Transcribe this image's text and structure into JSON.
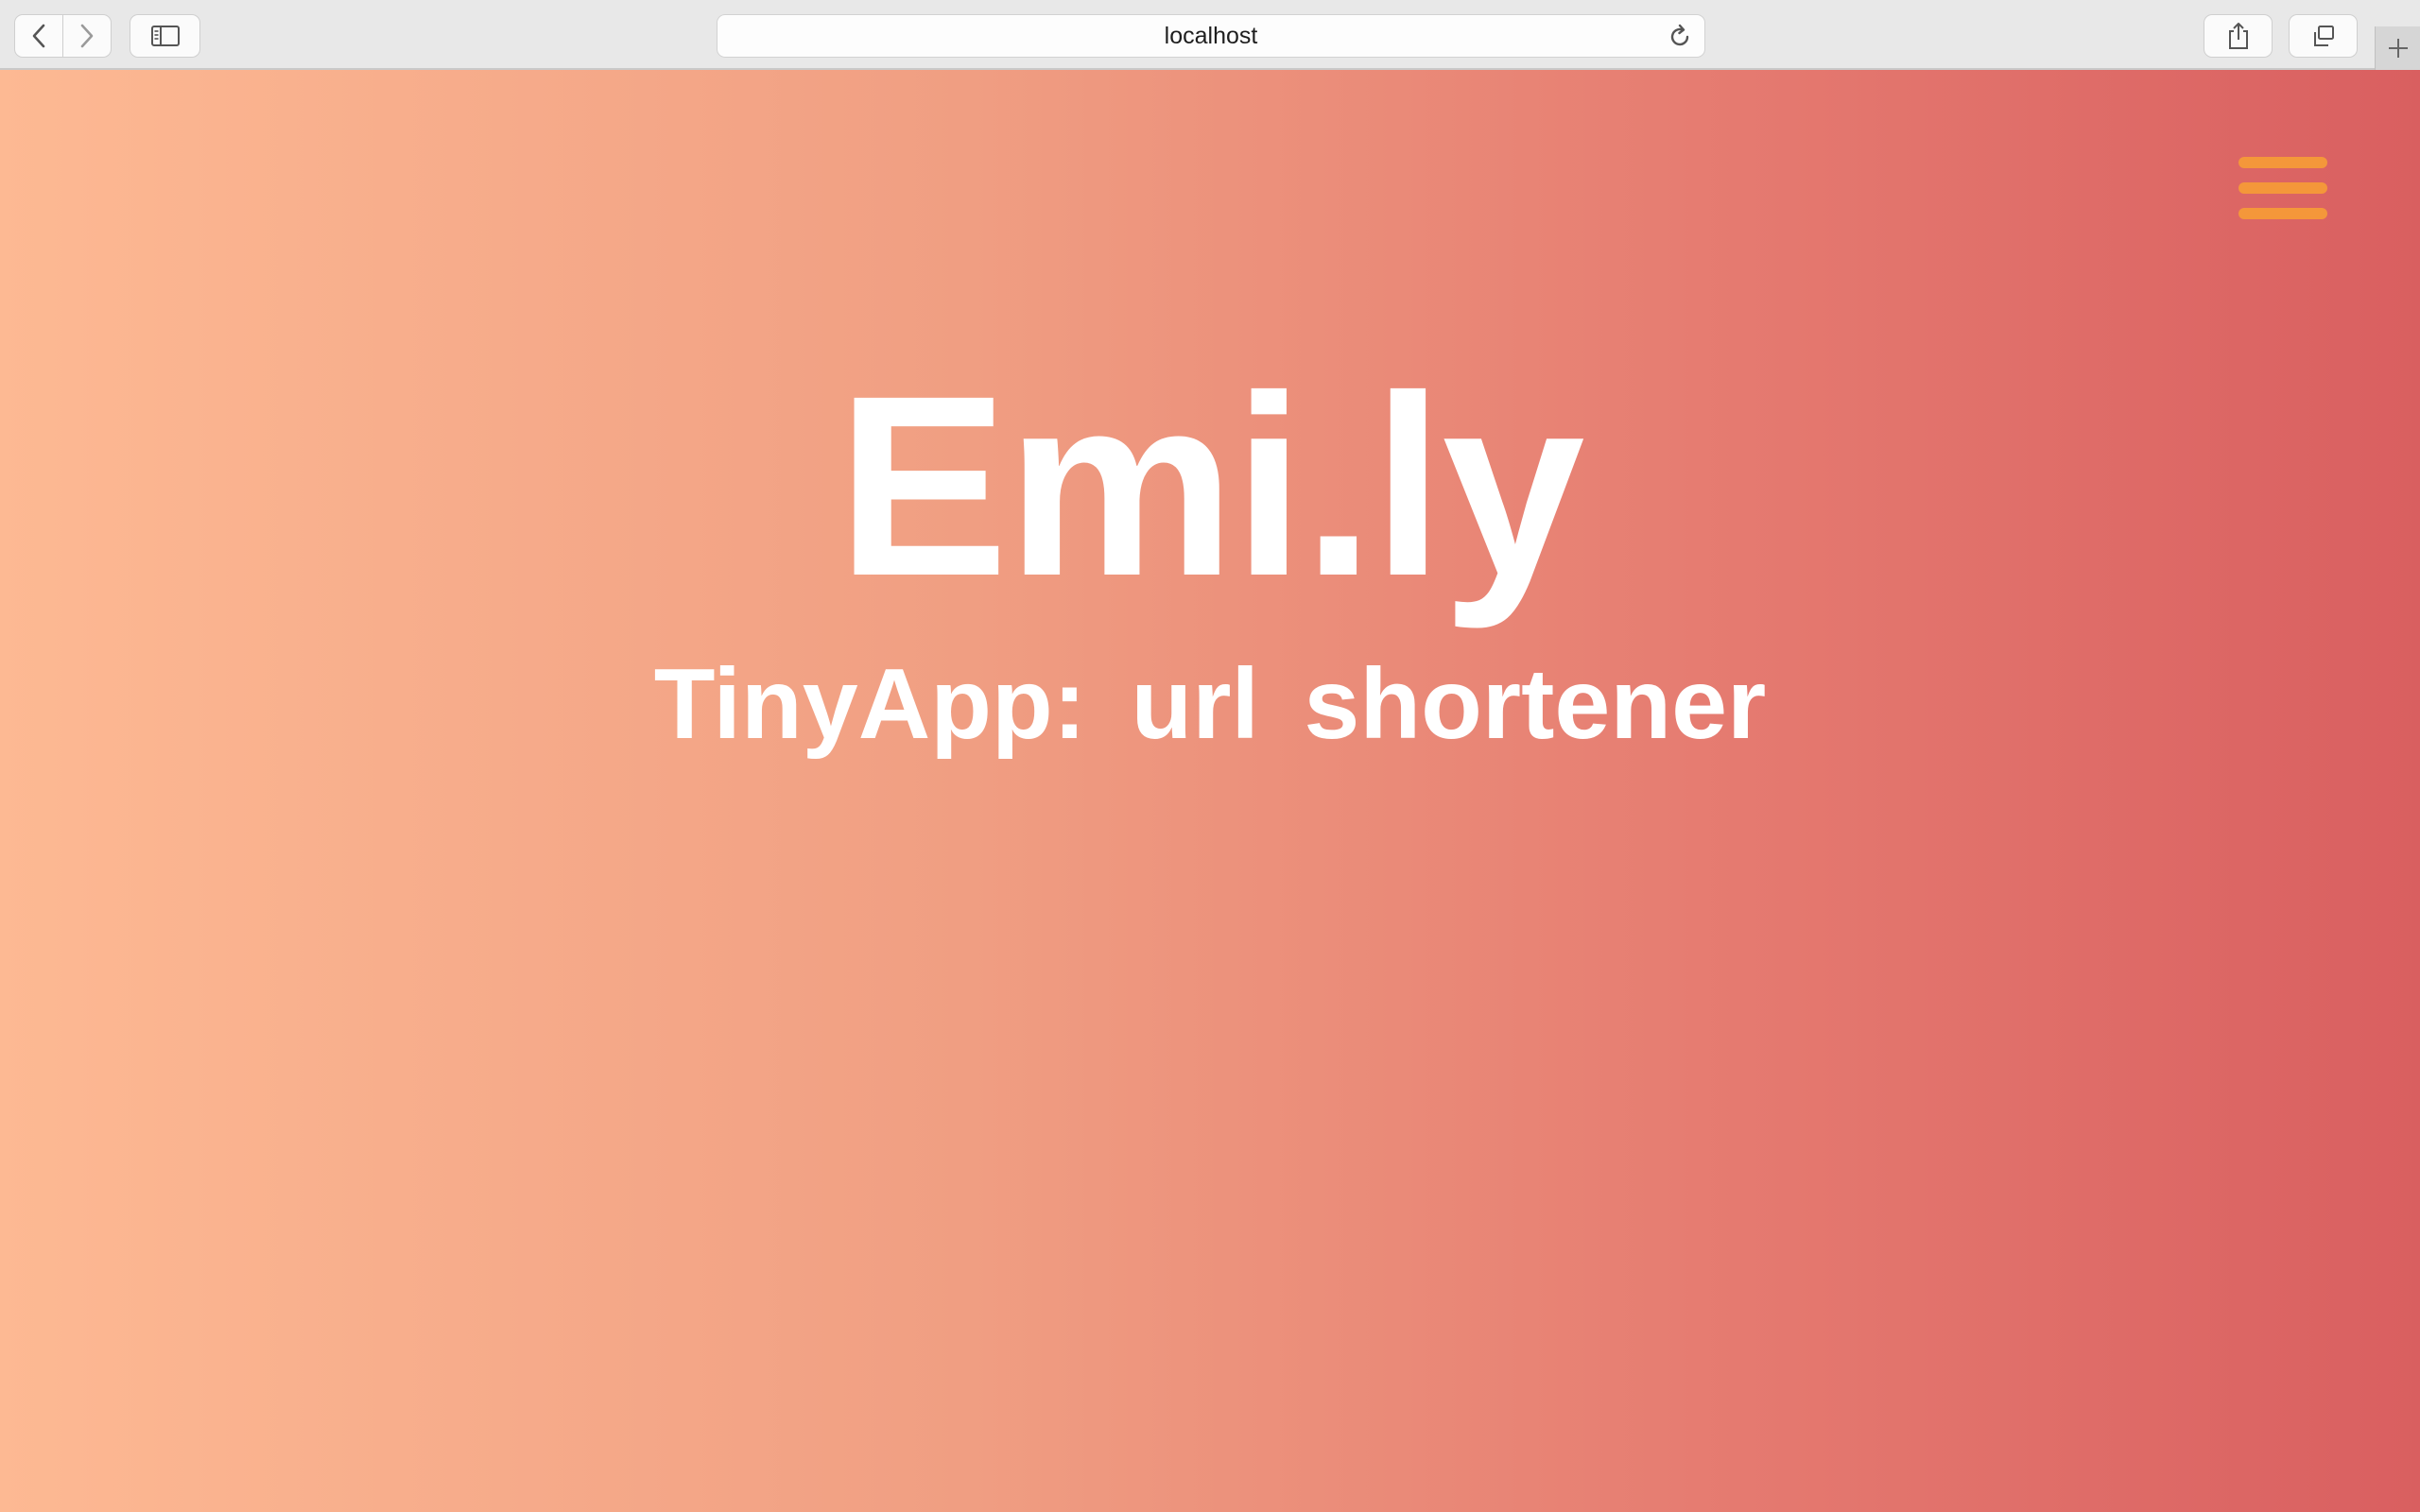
{
  "browser": {
    "address": "localhost",
    "icons": {
      "back": "chevron-left-icon",
      "forward": "chevron-right-icon",
      "sidebar": "sidebar-icon",
      "reload": "reload-icon",
      "share": "share-icon",
      "tabs": "tabs-overview-icon",
      "new_tab": "plus-icon"
    }
  },
  "page": {
    "menu_icon": "hamburger-menu-icon",
    "title": "Emi.ly",
    "subtitle": "TinyApp: url shortener",
    "colors": {
      "gradient_start": "#fdb993",
      "gradient_end": "#d95f60",
      "menu_accent": "#f4973a",
      "text": "#ffffff"
    }
  }
}
